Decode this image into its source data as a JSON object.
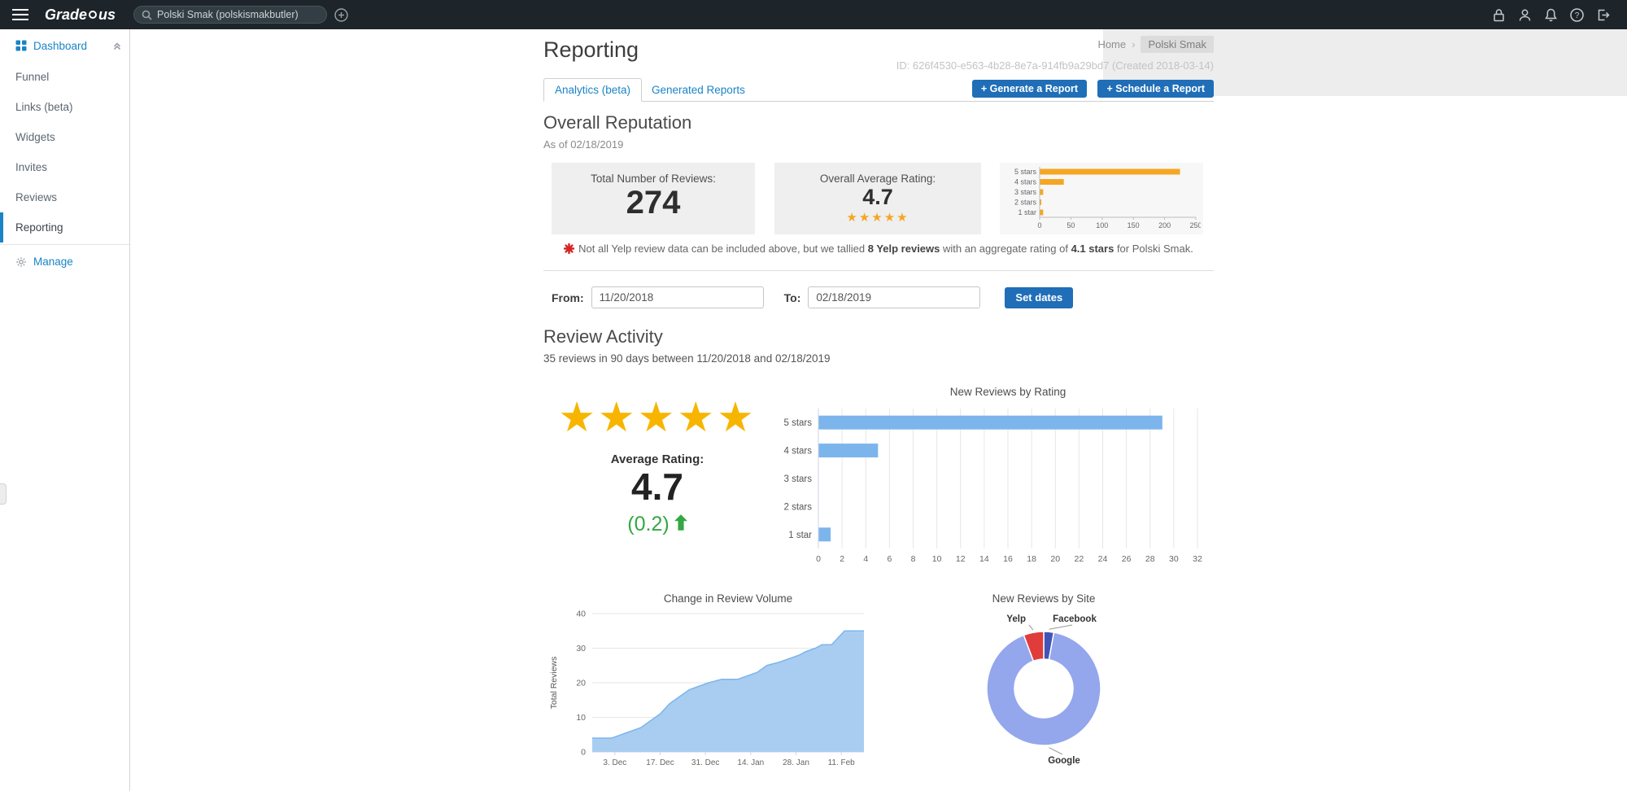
{
  "header": {
    "logo_part1": "Grade",
    "logo_part2": "us",
    "search_value": "Polski Smak (polskismakbutler)"
  },
  "sidebar": {
    "items": [
      {
        "label": "Dashboard"
      },
      {
        "label": "Funnel"
      },
      {
        "label": "Links (beta)"
      },
      {
        "label": "Widgets"
      },
      {
        "label": "Invites"
      },
      {
        "label": "Reviews"
      },
      {
        "label": "Reporting"
      },
      {
        "label": "Manage"
      }
    ]
  },
  "breadcrumb": {
    "home": "Home",
    "separator": "›",
    "current": "Polski Smak"
  },
  "page": {
    "title": "Reporting",
    "id_line": "ID: 626f4530-e563-4b28-8e7a-914fb9a29bd7 (Created 2018-03-14)",
    "tab_analytics": "Analytics (beta)",
    "tab_generated": "Generated Reports",
    "generate_button": "+ Generate a Report",
    "schedule_button": "+ Schedule a Report"
  },
  "overall": {
    "heading": "Overall Reputation",
    "as_of": "As of 02/18/2019",
    "total_label": "Total Number of Reviews:",
    "total_value": "274",
    "avg_label": "Overall Average Rating:",
    "avg_value": "4.7",
    "stars": "★★★★★",
    "yelp_note_prefix": "Not all Yelp review data can be included above, but we tallied ",
    "yelp_note_bold1": "8 Yelp reviews",
    "yelp_note_mid": " with an aggregate rating of ",
    "yelp_note_bold2": "4.1 stars",
    "yelp_note_suffix": " for Polski Smak."
  },
  "date_form": {
    "from_label": "From:",
    "from_value": "11/20/2018",
    "to_label": "To:",
    "to_value": "02/18/2019",
    "submit_label": "Set dates"
  },
  "activity": {
    "heading": "Review Activity",
    "subtitle": "35 reviews in 90 days between 11/20/2018 and 02/18/2019",
    "stars": "★★★★★",
    "avg_label": "Average Rating:",
    "avg_value": "4.7",
    "change_value": "(0.2)"
  },
  "colors": {
    "accent_blue": "#1a84c7",
    "button_blue": "#1f6eb7",
    "star_orange": "#f5a623",
    "bar_blue": "#7cb5ec",
    "positive_green": "#35a744",
    "yelp_red": "#d32323"
  },
  "chart_data": [
    {
      "id": "rating_distribution",
      "type": "bar",
      "orientation": "horizontal",
      "title": "",
      "categories": [
        "5 stars",
        "4 stars",
        "3 stars",
        "2 stars",
        "1 star"
      ],
      "values": [
        224,
        38,
        5,
        2,
        5
      ],
      "xlim": [
        0,
        250
      ],
      "xticks": [
        0,
        50,
        100,
        150,
        200,
        250
      ],
      "color": "#f5a623",
      "grid": false
    },
    {
      "id": "new_reviews_by_rating",
      "type": "bar",
      "orientation": "horizontal",
      "title": "New Reviews by Rating",
      "categories": [
        "5 stars",
        "4 stars",
        "3 stars",
        "2 stars",
        "1 star"
      ],
      "values": [
        29,
        5,
        0,
        0,
        1
      ],
      "xlim": [
        0,
        32
      ],
      "xticks": [
        0,
        2,
        4,
        6,
        8,
        10,
        12,
        14,
        16,
        18,
        20,
        22,
        24,
        26,
        28,
        30,
        32
      ],
      "color": "#7cb5ec",
      "grid": true
    },
    {
      "id": "review_volume",
      "type": "area",
      "title": "Change in Review Volume",
      "ylabel": "Total Reviews",
      "ylim": [
        0,
        40
      ],
      "yticks": [
        0,
        10,
        20,
        30,
        40
      ],
      "x_domain_days": [
        0,
        84
      ],
      "xticks_days": [
        7,
        21,
        35,
        49,
        63,
        77
      ],
      "xtick_labels": [
        "3. Dec",
        "17. Dec",
        "31. Dec",
        "14. Jan",
        "28. Jan",
        "11. Feb"
      ],
      "points": [
        [
          0,
          4
        ],
        [
          6,
          4
        ],
        [
          9,
          5
        ],
        [
          12,
          6
        ],
        [
          15,
          7
        ],
        [
          18,
          9
        ],
        [
          21,
          11
        ],
        [
          24,
          14
        ],
        [
          27,
          16
        ],
        [
          30,
          18
        ],
        [
          33,
          19
        ],
        [
          36,
          20
        ],
        [
          40,
          21
        ],
        [
          45,
          21
        ],
        [
          48,
          22
        ],
        [
          51,
          23
        ],
        [
          54,
          25
        ],
        [
          58,
          26
        ],
        [
          61,
          27
        ],
        [
          64,
          28
        ],
        [
          66,
          29
        ],
        [
          69,
          30
        ],
        [
          71,
          31
        ],
        [
          74,
          31
        ],
        [
          76,
          33
        ],
        [
          78,
          35
        ],
        [
          84,
          35
        ]
      ],
      "fill_color": "#a9cdf1",
      "line_color": "#7cb5ec",
      "grid": true
    },
    {
      "id": "new_reviews_by_site",
      "type": "pie",
      "donut": true,
      "title": "New Reviews by Site",
      "series": [
        {
          "name": "Facebook",
          "value": 1,
          "color": "#4254b5"
        },
        {
          "name": "Google",
          "value": 32,
          "color": "#94a6ec"
        },
        {
          "name": "Yelp",
          "value": 2,
          "color": "#e03c3c"
        }
      ]
    }
  ]
}
